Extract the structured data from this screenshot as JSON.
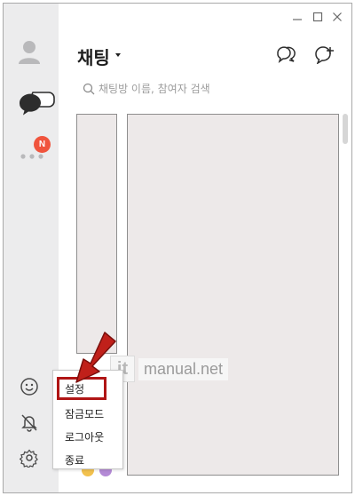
{
  "window": {
    "minimize_icon": "minimize-icon",
    "maximize_icon": "maximize-icon",
    "close_icon": "close-icon"
  },
  "sidebar": {
    "badge": "N",
    "icons": [
      "profile-icon",
      "chat-icon",
      "more-icon",
      "emoji-icon",
      "bell-off-icon",
      "gear-icon"
    ]
  },
  "header": {
    "title": "채팅",
    "open_chat_icon": "open-chat-icon",
    "new_chat_icon": "new-chat-icon"
  },
  "search": {
    "placeholder": "채팅방 이름, 참여자 검색"
  },
  "menu": {
    "items": [
      "설정",
      "잠금모드",
      "로그아웃",
      "종료"
    ]
  },
  "watermark": {
    "logo": "it",
    "text": "manual.net"
  },
  "colors": {
    "sidebar_bg": "#ececed",
    "badge": "#f0543d",
    "highlight": "#b01515",
    "panel": "#ede9e9"
  }
}
